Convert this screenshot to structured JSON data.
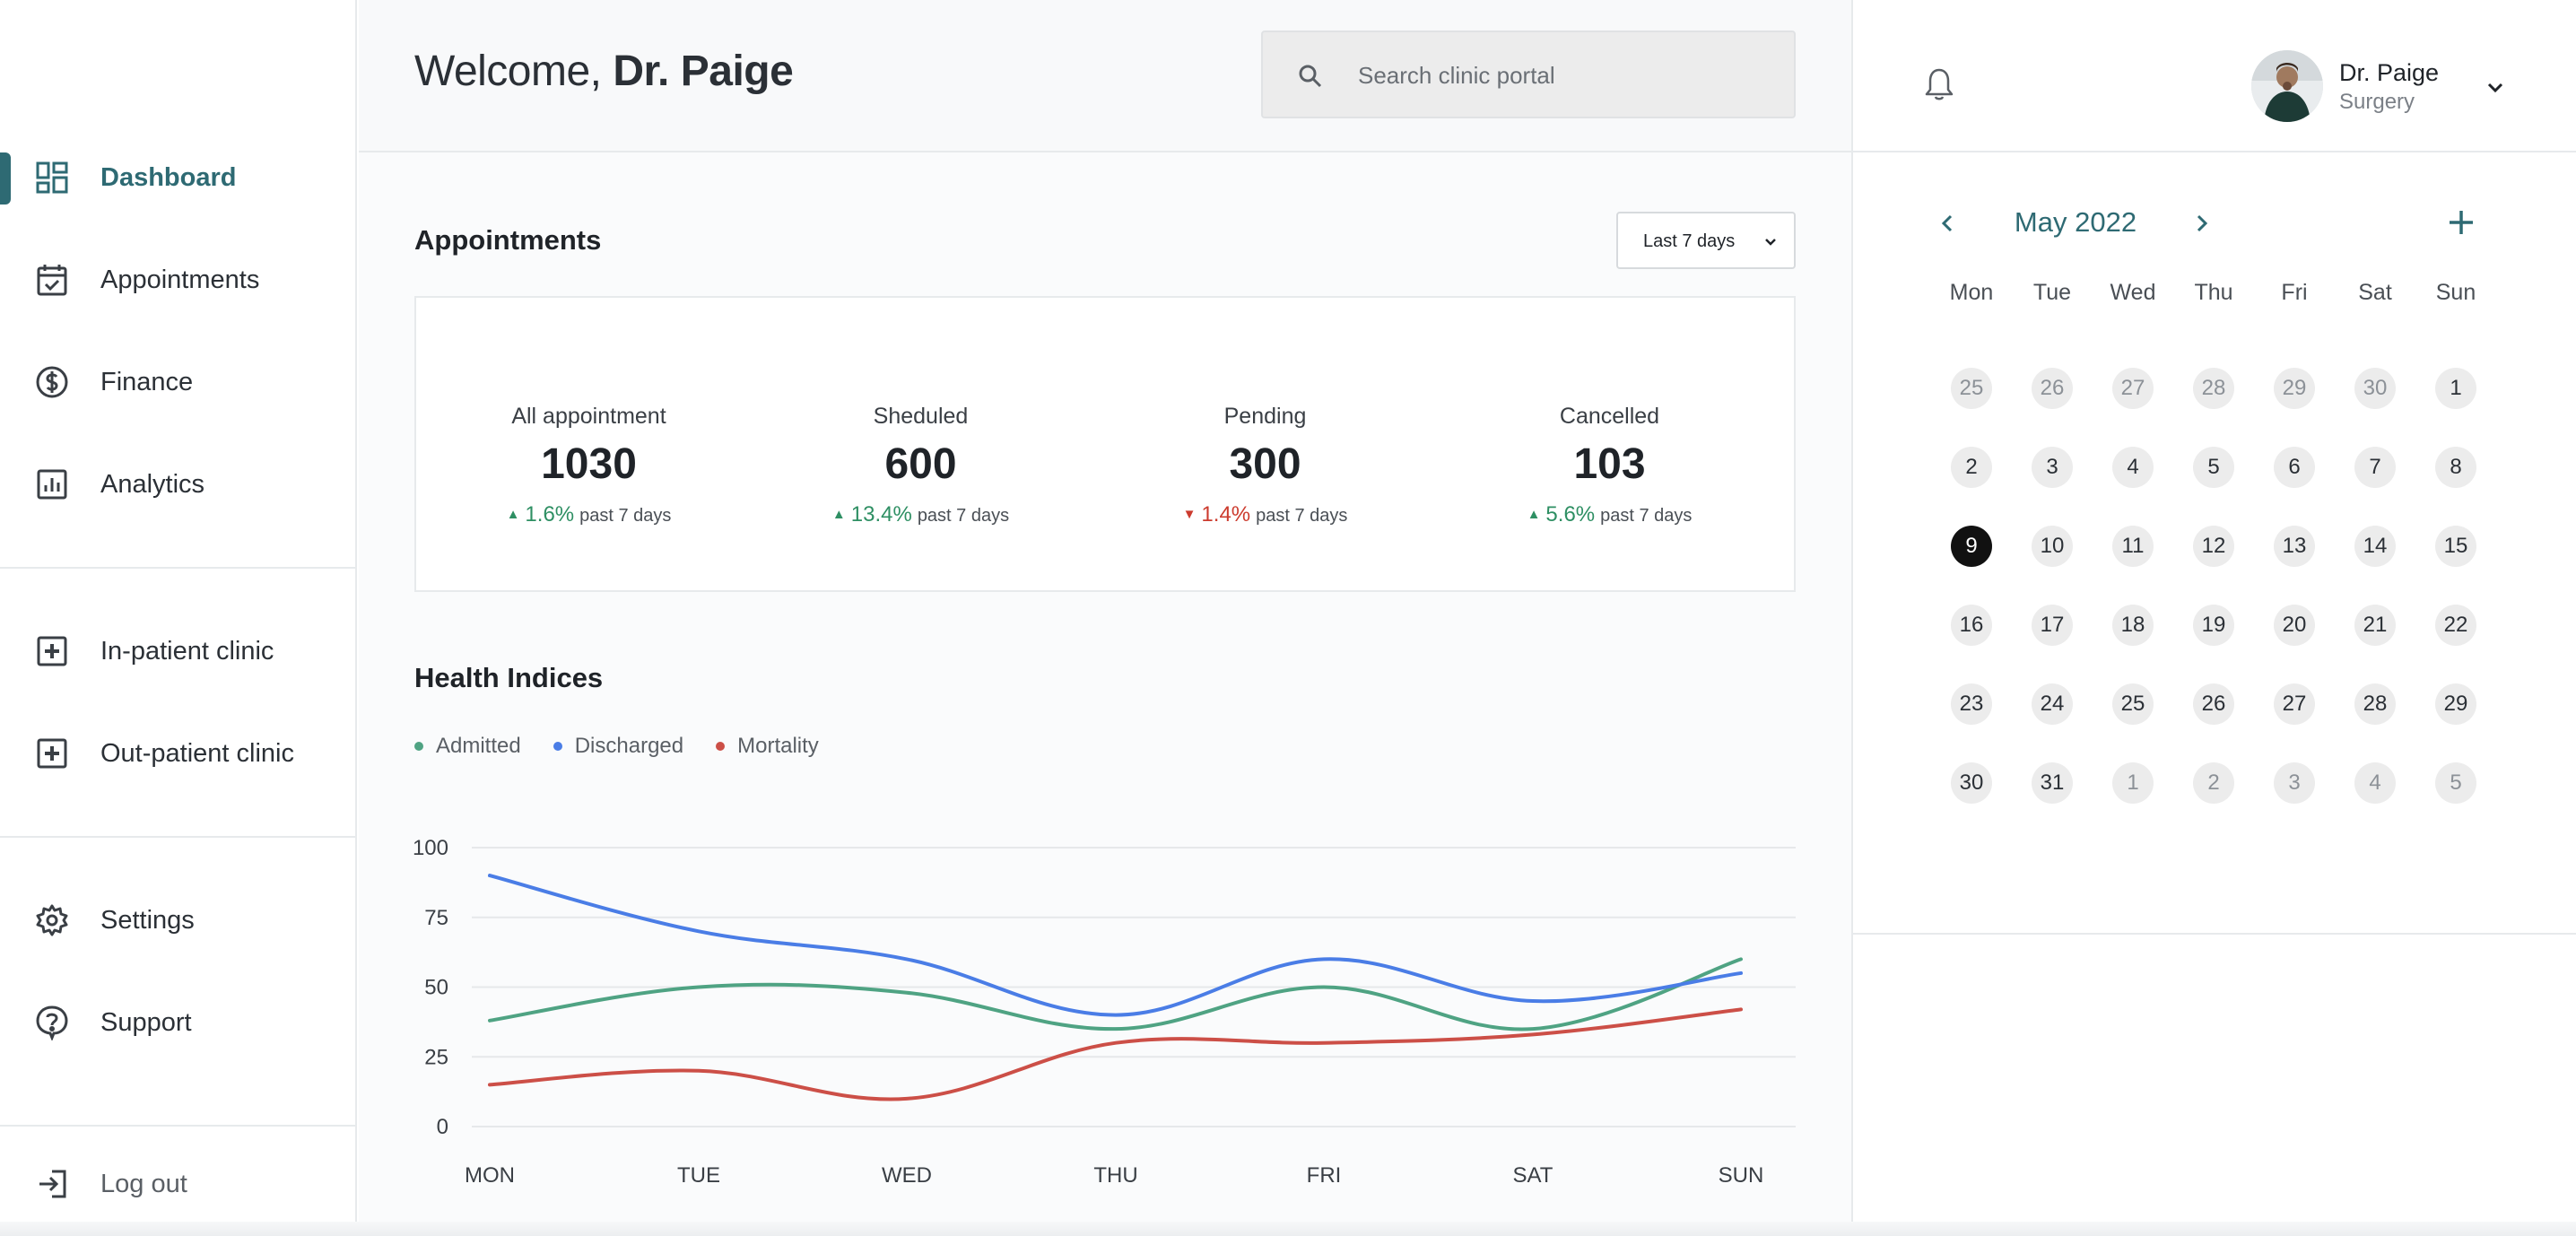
{
  "sidebar": {
    "items": [
      {
        "label": "Dashboard",
        "icon": "dashboard-icon",
        "active": true
      },
      {
        "label": "Appointments",
        "icon": "calendar-check-icon"
      },
      {
        "label": "Finance",
        "icon": "dollar-circle-icon"
      },
      {
        "label": "Analytics",
        "icon": "bar-chart-icon"
      },
      {
        "label": "In-patient clinic",
        "icon": "plus-square-icon"
      },
      {
        "label": "Out-patient clinic",
        "icon": "plus-square-icon"
      },
      {
        "label": "Settings",
        "icon": "gear-icon"
      },
      {
        "label": "Support",
        "icon": "question-bubble-icon"
      }
    ],
    "logout_label": "Log out"
  },
  "header": {
    "welcome_prefix": "Welcome,",
    "welcome_name": "Dr. Paige",
    "search_placeholder": "Search clinic portal"
  },
  "appointments": {
    "title": "Appointments",
    "range_label": "Last 7 days",
    "stats": [
      {
        "label": "All appointment",
        "value": "1030",
        "change": "1.6%",
        "direction": "up",
        "period": "past 7 days"
      },
      {
        "label": "Sheduled",
        "value": "600",
        "change": "13.4%",
        "direction": "up",
        "period": "past 7 days"
      },
      {
        "label": "Pending",
        "value": "300",
        "change": "1.4%",
        "direction": "down",
        "period": "past 7 days"
      },
      {
        "label": "Cancelled",
        "value": "103",
        "change": "5.6%",
        "direction": "up",
        "period": "past 7 days"
      }
    ]
  },
  "health": {
    "title": "Health Indices"
  },
  "chart_data": {
    "type": "line",
    "categories": [
      "MON",
      "TUE",
      "WED",
      "THU",
      "FRI",
      "SAT",
      "SUN"
    ],
    "ylim": [
      0,
      100
    ],
    "yticks": [
      0,
      25,
      50,
      75,
      100
    ],
    "grid": true,
    "legend": "top-left",
    "series": [
      {
        "name": "Admitted",
        "color": "#4fa383",
        "values": [
          38,
          50,
          48,
          35,
          50,
          35,
          60
        ]
      },
      {
        "name": "Discharged",
        "color": "#4a7de6",
        "values": [
          90,
          70,
          60,
          40,
          60,
          45,
          55
        ]
      },
      {
        "name": "Mortality",
        "color": "#cc4f47",
        "values": [
          15,
          20,
          10,
          30,
          30,
          33,
          42
        ]
      }
    ]
  },
  "user": {
    "name": "Dr. Paige",
    "role": "Surgery"
  },
  "calendar": {
    "title": "May 2022",
    "weekdays": [
      "Mon",
      "Tue",
      "Wed",
      "Thu",
      "Fri",
      "Sat",
      "Sun"
    ],
    "selected": 9,
    "weeks": [
      [
        {
          "d": "25",
          "m": true
        },
        {
          "d": "26",
          "m": true
        },
        {
          "d": "27",
          "m": true
        },
        {
          "d": "28",
          "m": true
        },
        {
          "d": "29",
          "m": true
        },
        {
          "d": "30",
          "m": true
        },
        {
          "d": "1"
        }
      ],
      [
        {
          "d": "2"
        },
        {
          "d": "3"
        },
        {
          "d": "4"
        },
        {
          "d": "5"
        },
        {
          "d": "6"
        },
        {
          "d": "7"
        },
        {
          "d": "8"
        }
      ],
      [
        {
          "d": "9"
        },
        {
          "d": "10"
        },
        {
          "d": "11"
        },
        {
          "d": "12"
        },
        {
          "d": "13"
        },
        {
          "d": "14"
        },
        {
          "d": "15"
        }
      ],
      [
        {
          "d": "16"
        },
        {
          "d": "17"
        },
        {
          "d": "18"
        },
        {
          "d": "19"
        },
        {
          "d": "20"
        },
        {
          "d": "21"
        },
        {
          "d": "22"
        }
      ],
      [
        {
          "d": "23"
        },
        {
          "d": "24"
        },
        {
          "d": "25"
        },
        {
          "d": "26"
        },
        {
          "d": "27"
        },
        {
          "d": "28"
        },
        {
          "d": "29"
        }
      ],
      [
        {
          "d": "30"
        },
        {
          "d": "31"
        },
        {
          "d": "1",
          "m": true
        },
        {
          "d": "2",
          "m": true
        },
        {
          "d": "3",
          "m": true
        },
        {
          "d": "4",
          "m": true
        },
        {
          "d": "5",
          "m": true
        }
      ]
    ]
  }
}
